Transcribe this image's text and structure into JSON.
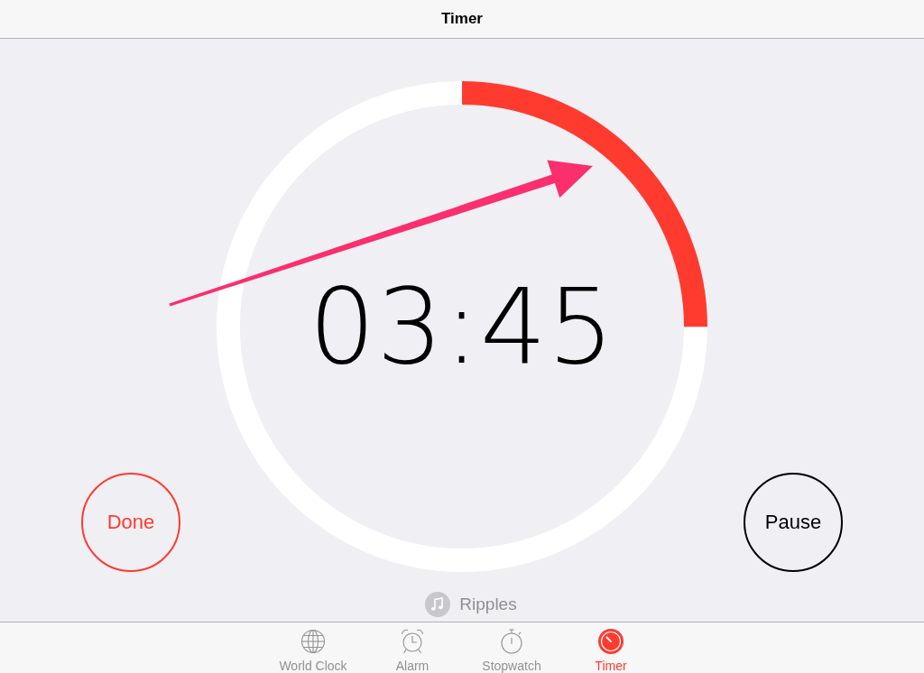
{
  "header": {
    "title": "Timer"
  },
  "timer": {
    "time": "03:45",
    "level": 0.25
  },
  "buttons": [
    {
      "label": "Done",
      "color": "#ff3b30"
    },
    {
      "label": "Pause",
      "color": "#000000"
    }
  ],
  "sound": {
    "label": "Ripples"
  },
  "tab_bar": {
    "tabs": [
      {
        "label": "World Clock",
        "selected": false
      },
      {
        "label": "Alarm",
        "selected": false
      },
      {
        "label": "Stopwatch",
        "selected": false
      },
      {
        "label": "Timer",
        "selected": true
      }
    ]
  }
}
